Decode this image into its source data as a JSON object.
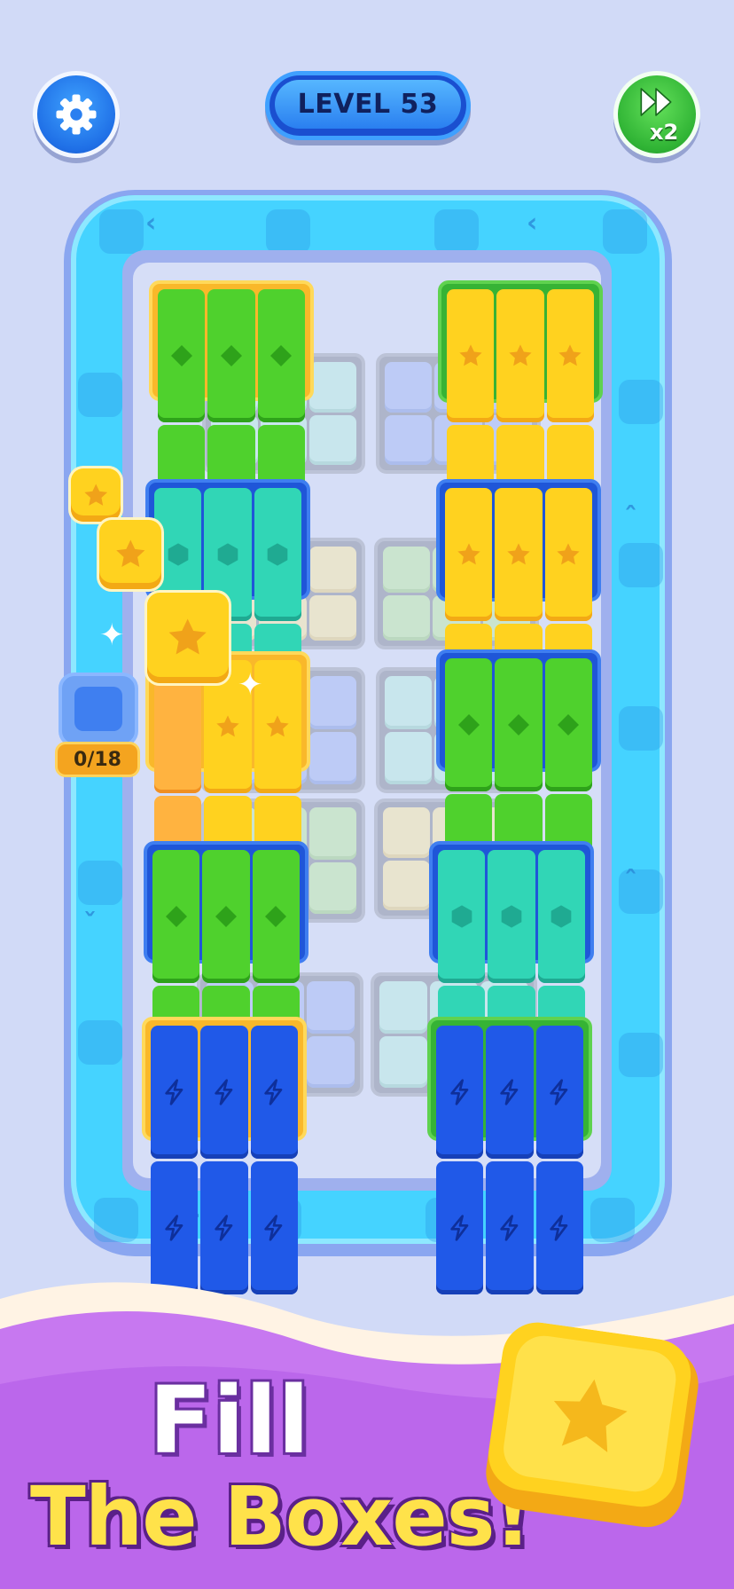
{
  "header": {
    "level_label": "LEVEL 53",
    "settings_icon": "gear-icon",
    "skip_icon": "fast-forward-icon",
    "skip_multiplier": "x2"
  },
  "collector": {
    "counter_text": "0/18"
  },
  "board": {
    "track_color": "#45d3ff",
    "front_trays": [
      {
        "frame": "yellow",
        "cell": "green",
        "symbol": "diamond"
      },
      {
        "frame": "green",
        "cell": "yellow",
        "symbol": "star"
      },
      {
        "frame": "blue",
        "cell": "teal",
        "symbol": "hexagon"
      },
      {
        "frame": "blue",
        "cell": "yellow",
        "symbol": "star"
      },
      {
        "frame": "yellow",
        "cell": "yellow",
        "symbol": "star"
      },
      {
        "frame": "blue",
        "cell": "green",
        "symbol": "diamond"
      },
      {
        "frame": "blue",
        "cell": "green",
        "symbol": "diamond"
      },
      {
        "frame": "blue",
        "cell": "teal",
        "symbol": "hexagon"
      },
      {
        "frame": "yellow",
        "cell": "blue",
        "symbol": "lightning"
      },
      {
        "frame": "green",
        "cell": "blue",
        "symbol": "lightning"
      }
    ]
  },
  "banner": {
    "line1": "Fill",
    "line2": "The Boxes!",
    "cube_icon": "star-icon"
  },
  "colors": {
    "background": "#d1daf7",
    "banner_purple": "#b35ce8",
    "banner_cream": "#fff3e4",
    "accent_yellow": "#ffd21f"
  }
}
